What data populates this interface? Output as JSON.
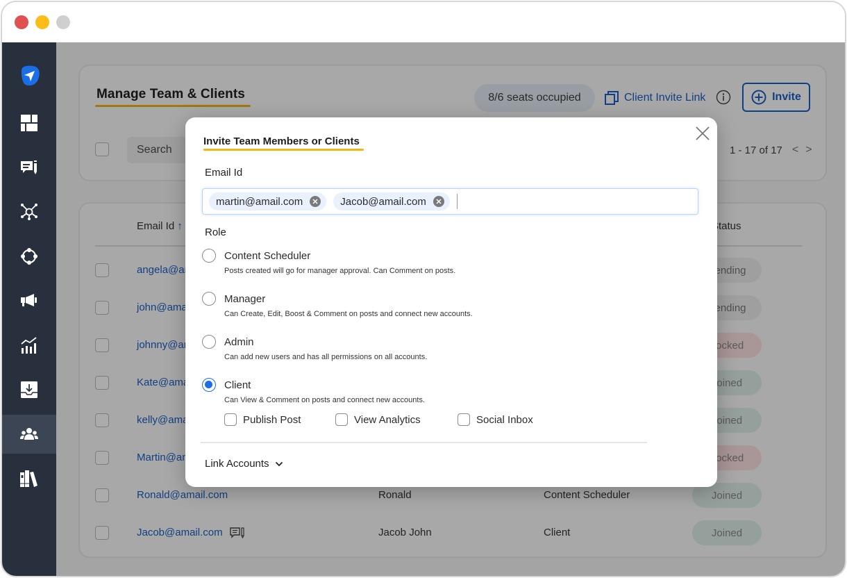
{
  "window": {
    "controls": [
      "close",
      "minimize",
      "maximize"
    ]
  },
  "sidebar": {
    "items": [
      {
        "icon": "paper-plane-logo-icon",
        "active": false
      },
      {
        "icon": "dashboard-icon",
        "active": false
      },
      {
        "icon": "comments-icon",
        "active": false
      },
      {
        "icon": "network-icon",
        "active": false
      },
      {
        "icon": "connections-icon",
        "active": false
      },
      {
        "icon": "megaphone-icon",
        "active": false
      },
      {
        "icon": "analytics-icon",
        "active": false
      },
      {
        "icon": "inbox-download-icon",
        "active": false
      },
      {
        "icon": "team-icon",
        "active": true
      },
      {
        "icon": "library-icon",
        "active": false
      }
    ]
  },
  "header": {
    "title": "Manage Team & Clients",
    "seats": "8/6 seats occupied",
    "client_invite_link": "Client Invite Link",
    "invite_label": "Invite",
    "search_placeholder": "Search",
    "pagination": "1 - 17 of 17",
    "prev": "<",
    "next": ">"
  },
  "table": {
    "columns": {
      "email": "Email Id",
      "sort_indicator": "↑",
      "status": "Status"
    },
    "rows": [
      {
        "email": "angela@amail.com",
        "name": "",
        "role": "",
        "status": "Pending",
        "status_kind": "pending"
      },
      {
        "email": "john@amail.com",
        "name": "",
        "role": "",
        "status": "Pending",
        "status_kind": "pending"
      },
      {
        "email": "johnny@amail.com",
        "name": "",
        "role": "",
        "status": "Locked",
        "status_kind": "locked"
      },
      {
        "email": "Kate@amail.com",
        "name": "",
        "role": "",
        "status": "Joined",
        "status_kind": "joined"
      },
      {
        "email": "kelly@amail.com",
        "name": "",
        "role": "",
        "status": "Joined",
        "status_kind": "joined"
      },
      {
        "email": "Martin@amail.com",
        "name": "",
        "role": "",
        "status": "Locked",
        "status_kind": "locked"
      },
      {
        "email": "Ronald@amail.com",
        "name": "Ronald",
        "role": "Content Scheduler",
        "status": "Joined",
        "status_kind": "joined"
      },
      {
        "email": "Jacob@amail.com",
        "name": "Jacob John",
        "role": "Client",
        "status": "Joined",
        "status_kind": "joined",
        "has_note_icon": true
      }
    ]
  },
  "modal": {
    "title": "Invite Team Members or Clients",
    "email_label": "Email Id",
    "emails": [
      "martin@amail.com",
      "Jacob@amail.com"
    ],
    "role_label": "Role",
    "roles": [
      {
        "label": "Content Scheduler",
        "description": "Posts created will go for manager approval. Can Comment on posts.",
        "selected": false
      },
      {
        "label": "Manager",
        "description": "Can Create, Edit, Boost & Comment on posts and connect new accounts.",
        "selected": false
      },
      {
        "label": "Admin",
        "description": "Can add new users and has all permissions on all accounts.",
        "selected": false
      },
      {
        "label": "Client",
        "description": "Can View & Comment on posts and connect new accounts.",
        "selected": true
      }
    ],
    "client_permissions": [
      {
        "label": "Publish Post",
        "checked": false
      },
      {
        "label": "View Analytics",
        "checked": false
      },
      {
        "label": "Social Inbox",
        "checked": false
      }
    ],
    "link_accounts": "Link Accounts"
  },
  "colors": {
    "accent": "#1a5fc4",
    "radio_selected": "#1a6fe8",
    "title_underline": "#f2b414",
    "sidebar_bg": "#28303e",
    "sidebar_active": "#3c4554",
    "logo_blue": "#1a6fe8"
  }
}
